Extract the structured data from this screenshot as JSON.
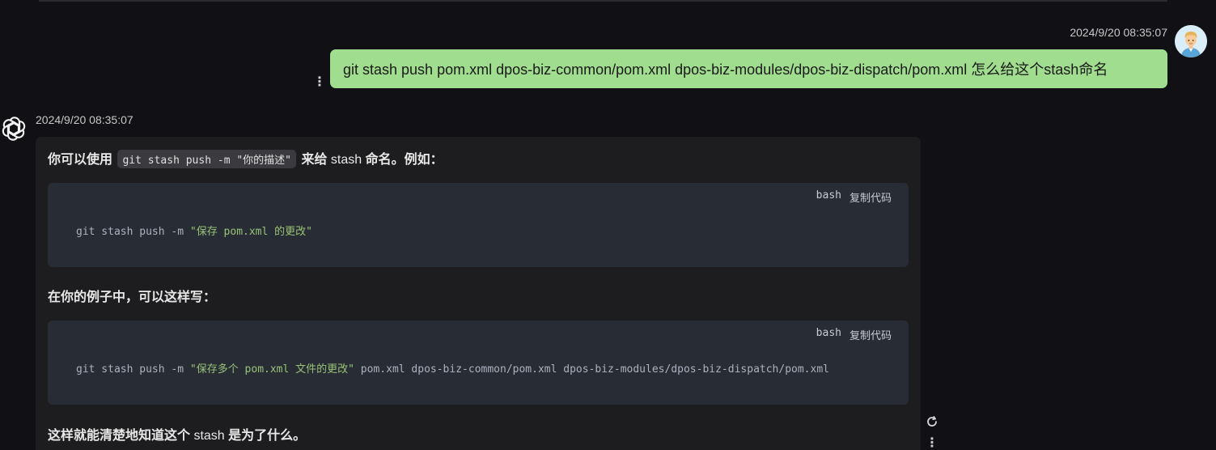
{
  "user_message": {
    "timestamp": "2024/9/20 08:35:07",
    "text": "git stash push pom.xml dpos-biz-common/pom.xml dpos-biz-modules/dpos-biz-dispatch/pom.xml 怎么给这个stash命名",
    "more_icon": "⋮",
    "bubble_color": "#a0dd8e"
  },
  "assistant_message": {
    "timestamp": "2024/9/20 08:35:07",
    "para1": {
      "before": "你可以使用",
      "code": "git stash push -m \"你的描述\"",
      "middle_bold": "来给",
      "plain": " stash ",
      "after": "命名。例如："
    },
    "code_block_1": {
      "lang": "bash",
      "copy_label": "复制代码",
      "cmd": "git stash push -m ",
      "string": "\"保存 pom.xml 的更改\"",
      "rest": ""
    },
    "para2": "在你的例子中，可以这样写：",
    "code_block_2": {
      "lang": "bash",
      "copy_label": "复制代码",
      "cmd": "git stash push -m ",
      "string": "\"保存多个 pom.xml 文件的更改\"",
      "rest": " pom.xml dpos-biz-common/pom.xml dpos-biz-modules/dpos-biz-dispatch/pom.xml"
    },
    "para3": {
      "before": "这样就能清楚地知道这个",
      "plain": " stash ",
      "after": "是为了什么。"
    },
    "more_icon": "⋮"
  },
  "colors": {
    "background": "#111014",
    "assistant_bubble": "#1d1d1f",
    "code_bg": "#282c34",
    "code_string": "#98c379"
  }
}
